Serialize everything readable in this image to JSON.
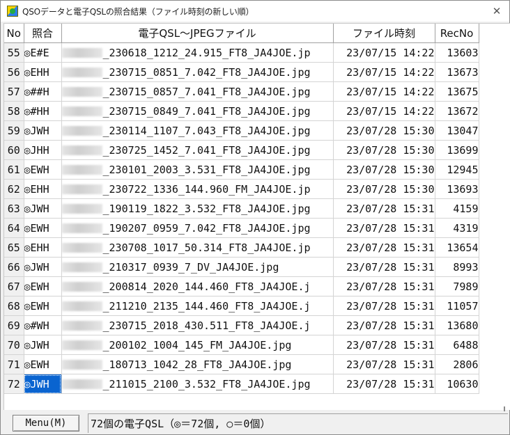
{
  "window": {
    "title": "QSOデータと電子QSLの照合結果（ファイル時刻の新しい順）",
    "close_glyph": "✕"
  },
  "columns": {
    "no": "No",
    "match": "照合",
    "file": "電子QSL～JPEGファイル",
    "time": "ファイル時刻",
    "rec": "RecNo"
  },
  "rows": [
    {
      "no": "55",
      "match": "◎E#E",
      "file": "_230618_1212_24.915_FT8_JA4JOE.jp",
      "time": "23/07/15 14:22",
      "rec": "13603"
    },
    {
      "no": "56",
      "match": "◎EHH",
      "file": "_230715_0851_7.042_FT8_JA4JOE.jpg",
      "time": "23/07/15 14:22",
      "rec": "13673"
    },
    {
      "no": "57",
      "match": "◎##H",
      "file": "_230715_0857_7.041_FT8_JA4JOE.jpg",
      "time": "23/07/15 14:22",
      "rec": "13675"
    },
    {
      "no": "58",
      "match": "◎#HH",
      "file": "_230715_0849_7.041_FT8_JA4JOE.jpg",
      "time": "23/07/15 14:22",
      "rec": "13672"
    },
    {
      "no": "59",
      "match": "◎JWH",
      "file": "_230114_1107_7.043_FT8_JA4JOE.jpg",
      "time": "23/07/28 15:30",
      "rec": "13047"
    },
    {
      "no": "60",
      "match": "◎JHH",
      "file": "_230725_1452_7.041_FT8_JA4JOE.jpg",
      "time": "23/07/28 15:30",
      "rec": "13699"
    },
    {
      "no": "61",
      "match": "◎EWH",
      "file": "_230101_2003_3.531_FT8_JA4JOE.jpg",
      "time": "23/07/28 15:30",
      "rec": "12945"
    },
    {
      "no": "62",
      "match": "◎EHH",
      "file": "_230722_1336_144.960_FM_JA4JOE.jp",
      "time": "23/07/28 15:30",
      "rec": "13693"
    },
    {
      "no": "63",
      "match": "◎JWH",
      "file": "_190119_1822_3.532_FT8_JA4JOE.jpg",
      "time": "23/07/28 15:31",
      "rec": "4159"
    },
    {
      "no": "64",
      "match": "◎EWH",
      "file": "_190207_0959_7.042_FT8_JA4JOE.jpg",
      "time": "23/07/28 15:31",
      "rec": "4319"
    },
    {
      "no": "65",
      "match": "◎EHH",
      "file": "_230708_1017_50.314_FT8_JA4JOE.jp",
      "time": "23/07/28 15:31",
      "rec": "13654"
    },
    {
      "no": "66",
      "match": "◎JWH",
      "file": "_210317_0939_7_DV_JA4JOE.jpg",
      "time": "23/07/28 15:31",
      "rec": "8993"
    },
    {
      "no": "67",
      "match": "◎EWH",
      "file": "_200814_2020_144.460_FT8_JA4JOE.j",
      "time": "23/07/28 15:31",
      "rec": "7989"
    },
    {
      "no": "68",
      "match": "◎EWH",
      "file": "_211210_2135_144.460_FT8_JA4JOE.j",
      "time": "23/07/28 15:31",
      "rec": "11057"
    },
    {
      "no": "69",
      "match": "◎#WH",
      "file": "_230715_2018_430.511_FT8_JA4JOE.j",
      "time": "23/07/28 15:31",
      "rec": "13680"
    },
    {
      "no": "70",
      "match": "◎JWH",
      "file": "_200102_1004_145_FM_JA4JOE.jpg",
      "time": "23/07/28 15:31",
      "rec": "6488"
    },
    {
      "no": "71",
      "match": "◎EWH",
      "file": "_180713_1042_28_FT8_JA4JOE.jpg",
      "time": "23/07/28 15:31",
      "rec": "2806"
    },
    {
      "no": "72",
      "match": "◎JWH",
      "file": "_211015_2100_3.532_FT8_JA4JOE.jpg",
      "time": "23/07/28 15:31",
      "rec": "10630",
      "selected": true
    }
  ],
  "status": {
    "menu_label": "Menu(M)",
    "summary": "72個の電子QSL（◎＝72個, ○＝0個）"
  },
  "colors": {
    "selection": "#0a64d0",
    "icon_yellow": "#ffd400",
    "icon_blue": "#2b7de9"
  }
}
